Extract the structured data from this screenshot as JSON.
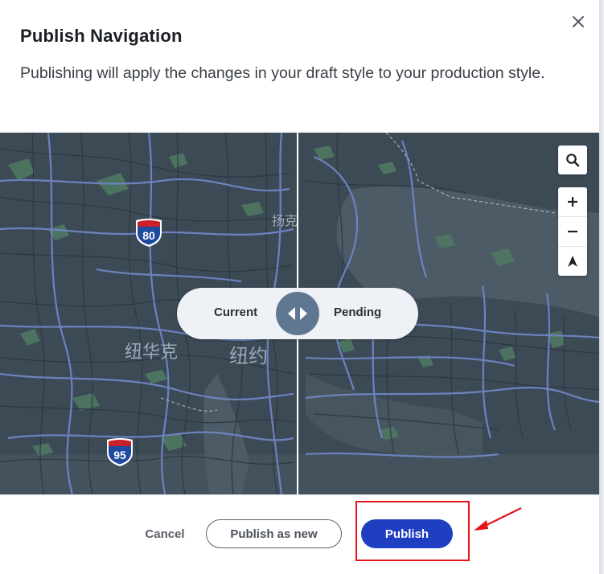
{
  "dialog": {
    "title": "Publish Navigation",
    "description": "Publishing will apply the changes in your draft style to your production style."
  },
  "comparison": {
    "left_label": "Current",
    "right_label": "Pending"
  },
  "map": {
    "labels": {
      "newark": "纽华克",
      "newyork": "纽约",
      "yonkers": "扬克"
    },
    "shields": {
      "i80": "80",
      "i95": "95"
    },
    "controls": {
      "search": "search-icon",
      "zoom_in": "plus-icon",
      "zoom_out": "minus-icon",
      "compass": "compass-icon"
    }
  },
  "footer": {
    "cancel_label": "Cancel",
    "publish_new_label": "Publish as new",
    "publish_label": "Publish"
  },
  "colors": {
    "primary": "#1f3fc2",
    "map_base": "#3b4955",
    "road": "#6e86c4",
    "annotation": "#e8141b"
  }
}
